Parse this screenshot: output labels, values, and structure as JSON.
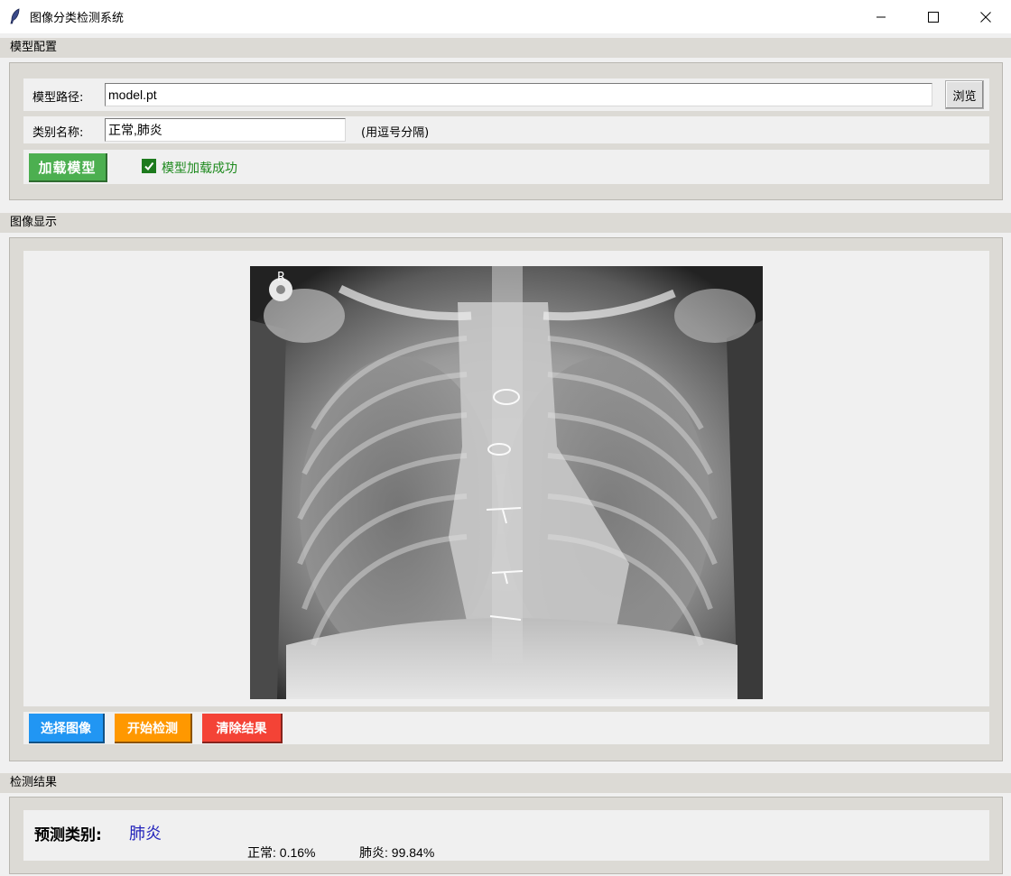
{
  "window": {
    "title": "图像分类检测系统",
    "icon": "feather-icon"
  },
  "model_config": {
    "section_title": "模型配置",
    "model_path_label": "模型路径:",
    "model_path_value": "model.pt",
    "browse_label": "浏览",
    "class_names_label": "类别名称:",
    "class_names_value": "正常,肺炎",
    "class_names_hint": "(用逗号分隔)",
    "load_button_label": "加载模型",
    "load_status": "模型加载成功",
    "load_status_checked": true
  },
  "image_display": {
    "section_title": "图像显示",
    "image_description_icon": "chest-xray-image",
    "buttons": {
      "select_image": "选择图像",
      "start_detect": "开始检测",
      "clear_result": "清除结果"
    },
    "button_colors": {
      "select_image": "#2196f3",
      "start_detect": "#ff9800",
      "clear_result": "#f44336"
    }
  },
  "results": {
    "section_title": "检测结果",
    "predicted_label": "预测类别:",
    "predicted_value": "肺炎",
    "probabilities": [
      {
        "text": "正常: 0.16%"
      },
      {
        "text": "肺炎: 99.84%"
      }
    ]
  },
  "colors": {
    "load_button": "#4caf50",
    "status_text": "#1e8a1e",
    "prediction_text": "#2222bb",
    "group_background": "#dcdad5",
    "panel_background": "#f0f0f0"
  }
}
